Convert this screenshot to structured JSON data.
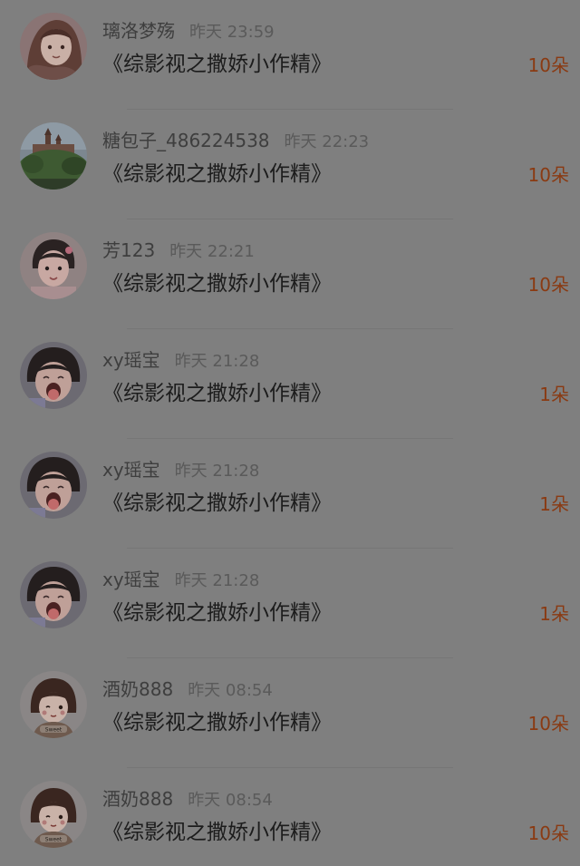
{
  "gifts": [
    {
      "user": "璃洛梦殇",
      "time": "昨天 23:59",
      "title": "《综影视之撒娇小作精》",
      "amount": "10朵",
      "avatar": "anime-girl-avatar"
    },
    {
      "user": "糖包子_486224538",
      "time": "昨天 22:23",
      "title": "《综影视之撒娇小作精》",
      "amount": "10朵",
      "avatar": "castle-landscape-avatar"
    },
    {
      "user": "芳123",
      "time": "昨天 22:21",
      "title": "《综影视之撒娇小作精》",
      "amount": "10朵",
      "avatar": "child-photo-avatar"
    },
    {
      "user": "xy瑶宝",
      "time": "昨天 21:28",
      "title": "《综影视之撒娇小作精》",
      "amount": "1朵",
      "avatar": "toddler-tongue-avatar"
    },
    {
      "user": "xy瑶宝",
      "time": "昨天 21:28",
      "title": "《综影视之撒娇小作精》",
      "amount": "1朵",
      "avatar": "toddler-tongue-avatar"
    },
    {
      "user": "xy瑶宝",
      "time": "昨天 21:28",
      "title": "《综影视之撒娇小作精》",
      "amount": "1朵",
      "avatar": "toddler-tongue-avatar"
    },
    {
      "user": "酒奶888",
      "time": "昨天 08:54",
      "title": "《综影视之撒娇小作精》",
      "amount": "10朵",
      "avatar": "cartoon-girl-sweet-avatar"
    },
    {
      "user": "酒奶888",
      "time": "昨天 08:54",
      "title": "《综影视之撒娇小作精》",
      "amount": "10朵",
      "avatar": "cartoon-girl-sweet-avatar"
    }
  ],
  "colors": {
    "accent_amount": "#8a3a12",
    "overlay_background": "#7f7f7f"
  }
}
